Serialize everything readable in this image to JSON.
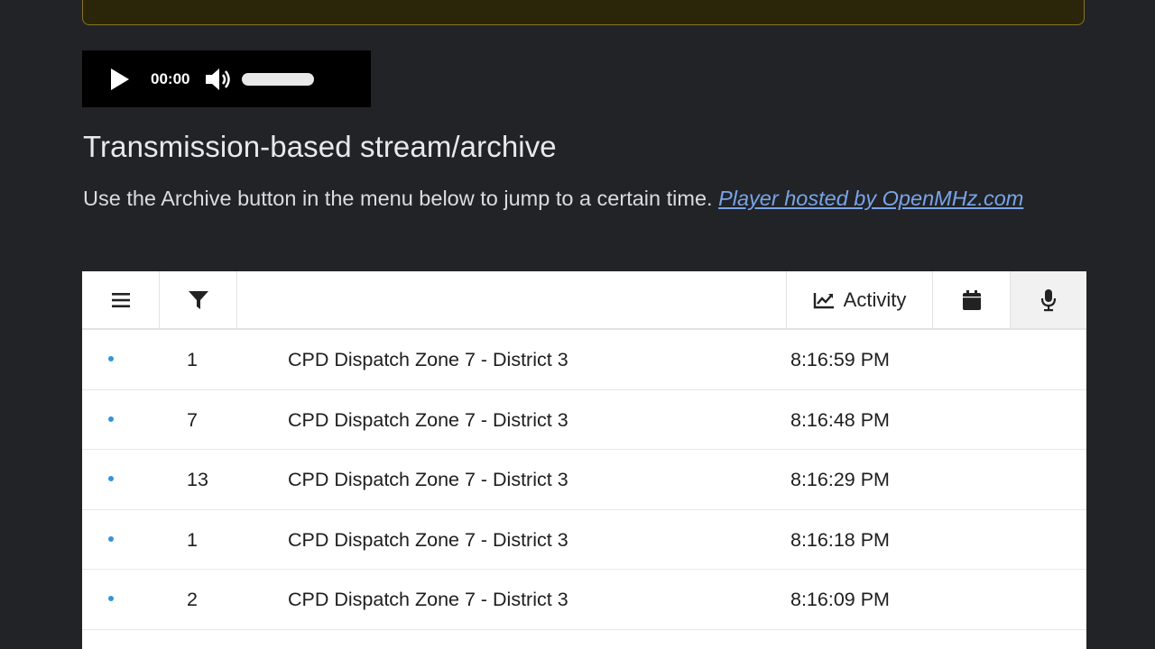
{
  "player": {
    "time": "00:00",
    "play_icon": "play-icon",
    "volume_icon": "volume-icon"
  },
  "heading": "Transmission-based stream/archive",
  "description": {
    "text": "Use the Archive button in the menu below to jump to a certain time. ",
    "link": "Player hosted by OpenMHz.com"
  },
  "toolbar": {
    "menu_icon": "menu-icon",
    "filter_icon": "filter-icon",
    "activity_label": "Activity",
    "activity_icon": "line-chart-icon",
    "calendar_icon": "calendar-icon",
    "mic_icon": "microphone-icon"
  },
  "rows": [
    {
      "count": "1",
      "talkgroup": "CPD Dispatch Zone 7 - District 3",
      "time": "8:16:59 PM"
    },
    {
      "count": "7",
      "talkgroup": "CPD Dispatch Zone 7 - District 3",
      "time": "8:16:48 PM"
    },
    {
      "count": "13",
      "talkgroup": "CPD Dispatch Zone 7 - District 3",
      "time": "8:16:29 PM"
    },
    {
      "count": "1",
      "talkgroup": "CPD Dispatch Zone 7 - District 3",
      "time": "8:16:18 PM"
    },
    {
      "count": "2",
      "talkgroup": "CPD Dispatch Zone 7 - District 3",
      "time": "8:16:09 PM"
    }
  ],
  "colors": {
    "background": "#212327",
    "link": "#7aa4e6",
    "dot": "#3395d8"
  }
}
